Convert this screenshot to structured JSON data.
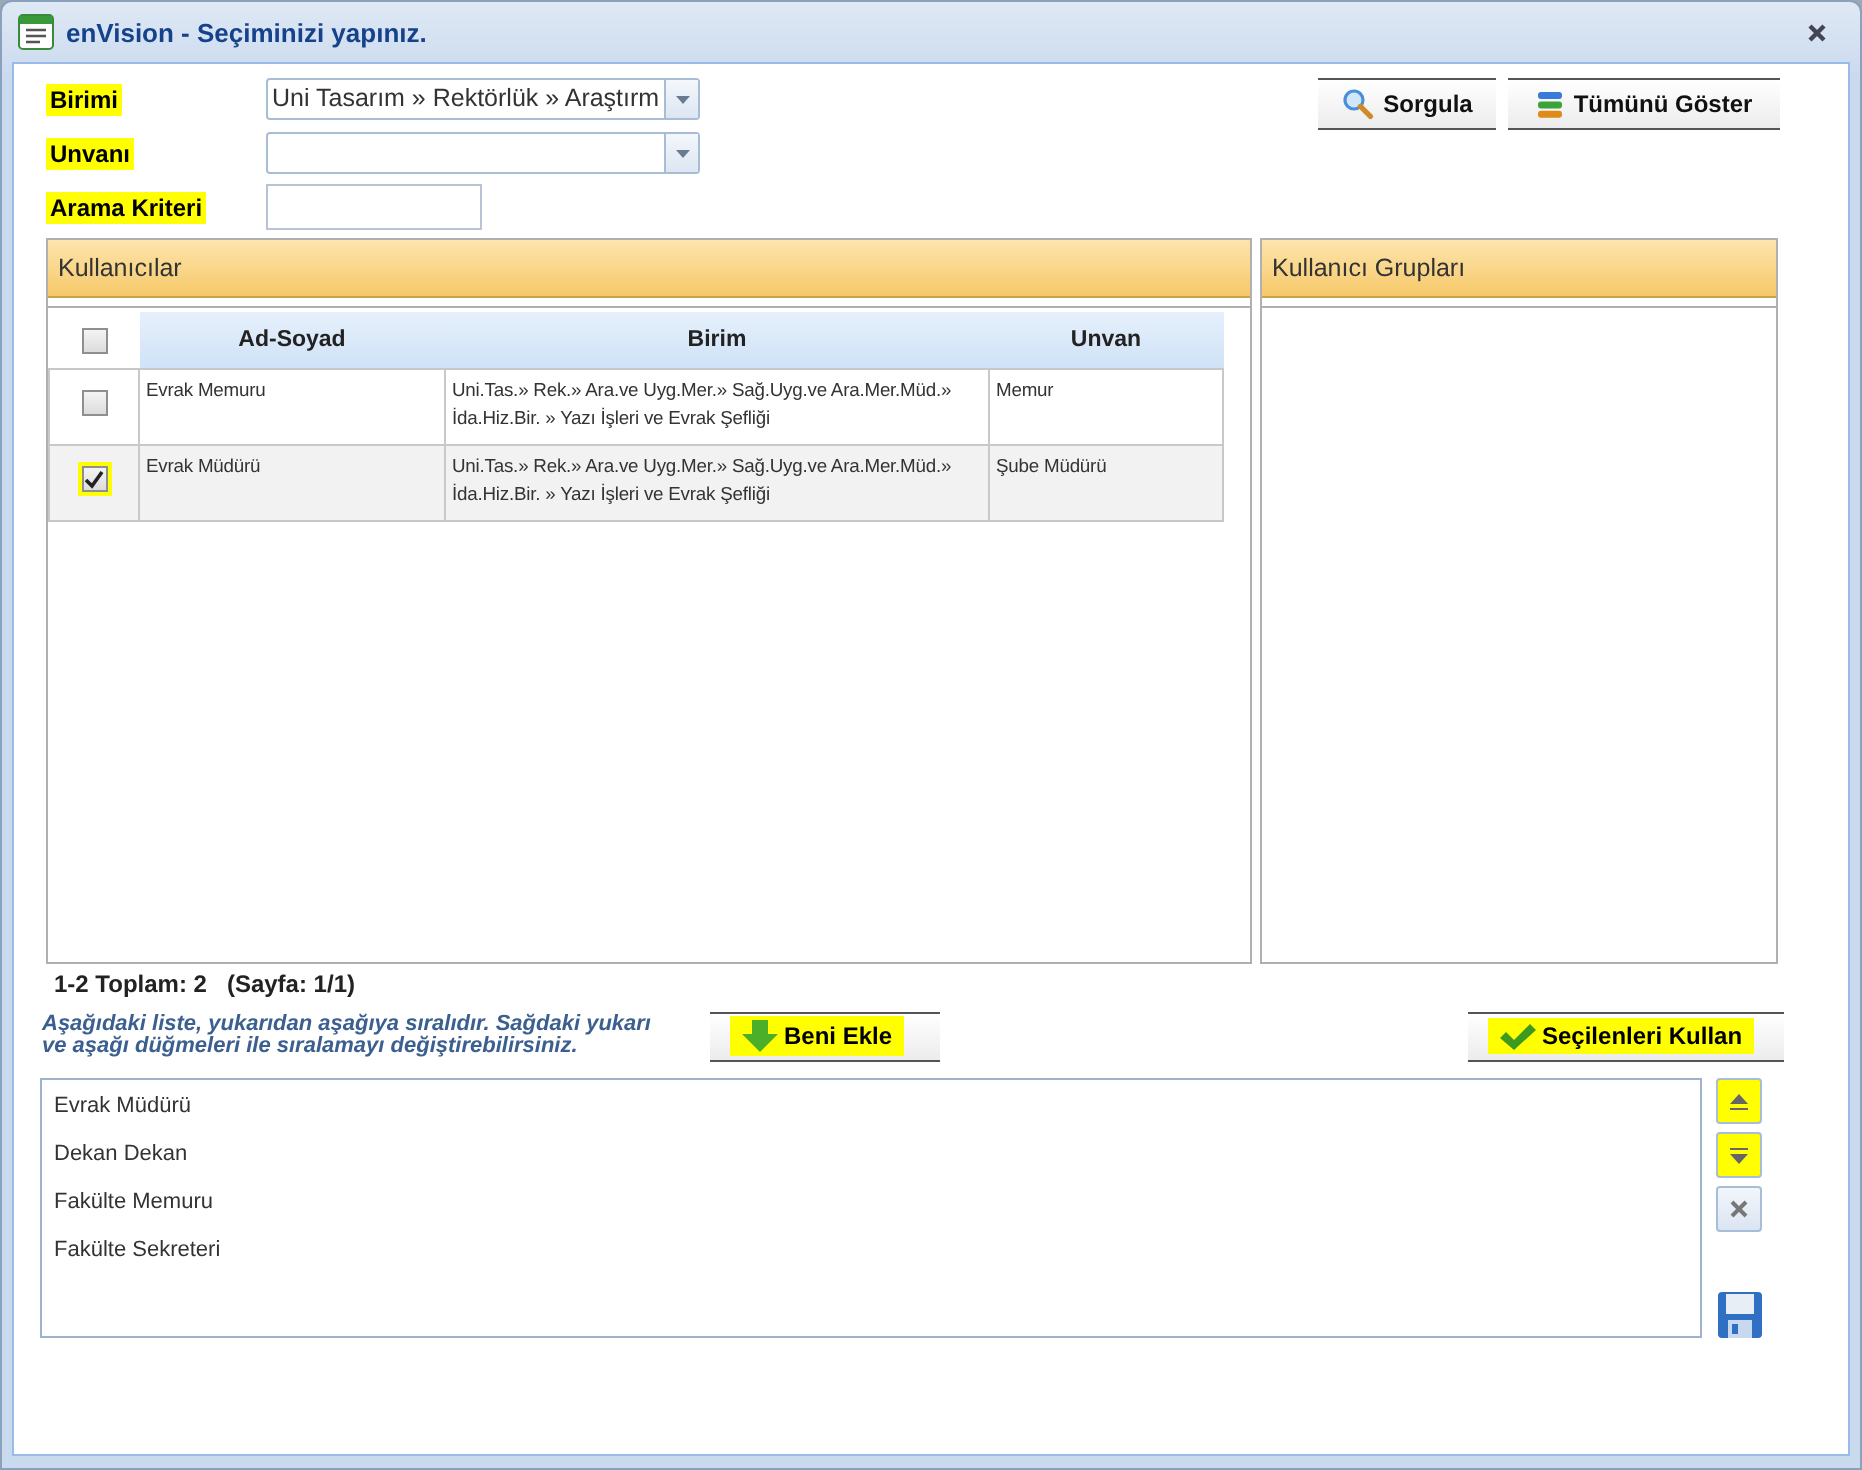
{
  "window": {
    "title": "enVision - Seçiminizi yapınız."
  },
  "filters": [
    {
      "label": "Birimi",
      "highlighted": true,
      "kind": "combo",
      "value": "Uni Tasarım » Rektörlük » Araştırm"
    },
    {
      "label": "Unvanı",
      "highlighted": true,
      "kind": "combo"
    },
    {
      "label": "Arama Kriteri",
      "highlighted": true,
      "kind": "text"
    }
  ],
  "top_buttons": [
    {
      "label": "Sorgula",
      "kind": "search"
    },
    {
      "label": "Tümünü Göster",
      "kind": "stack"
    }
  ],
  "users_panel": {
    "title": "Kullanıcılar",
    "select_all_checked": false,
    "columns": [
      "Ad-Soyad",
      "Birim",
      "Unvan"
    ],
    "rows": [
      {
        "checked": false,
        "highlighted": false,
        "cells": [
          "Evrak Memuru",
          "Uni.Tas.» Rek.» Ara.ve Uyg.Mer.» Sağ.Uyg.ve Ara.Mer.Müd.» İda.Hiz.Bir. » Yazı İşleri ve Evrak Şefliği",
          "Memur"
        ]
      },
      {
        "checked": true,
        "highlighted": true,
        "cells": [
          "Evrak Müdürü",
          "Uni.Tas.» Rek.» Ara.ve Uyg.Mer.» Sağ.Uyg.ve Ara.Mer.Müd.» İda.Hiz.Bir. » Yazı İşleri ve Evrak Şefliği",
          "Şube Müdürü"
        ]
      }
    ]
  },
  "groups_panel": {
    "title": "Kullanıcı Grupları"
  },
  "pager": "1-2 Toplam: 2   (Sayfa: 1/1)",
  "instructions": "Aşağıdaki liste, yukarıdan aşağıya sıralıdır. Sağdaki yukarı ve aşağı düğmeleri ile sıralamayı değiştirebilirsiniz.",
  "actions": [
    {
      "label": "Beni Ekle",
      "kind": "add",
      "highlighted": true
    },
    {
      "label": "Seçilenleri Kullan",
      "kind": "use",
      "highlighted": true
    }
  ],
  "order_list": {
    "items": [
      "Evrak Müdürü",
      "Dekan Dekan",
      "Fakülte Memuru",
      "Fakülte Sekreteri"
    ]
  },
  "side_buttons": [
    {
      "kind": "up",
      "highlighted": true
    },
    {
      "kind": "down",
      "highlighted": true
    },
    {
      "kind": "remove",
      "highlighted": false
    },
    {
      "kind": "save",
      "highlighted": false
    }
  ]
}
